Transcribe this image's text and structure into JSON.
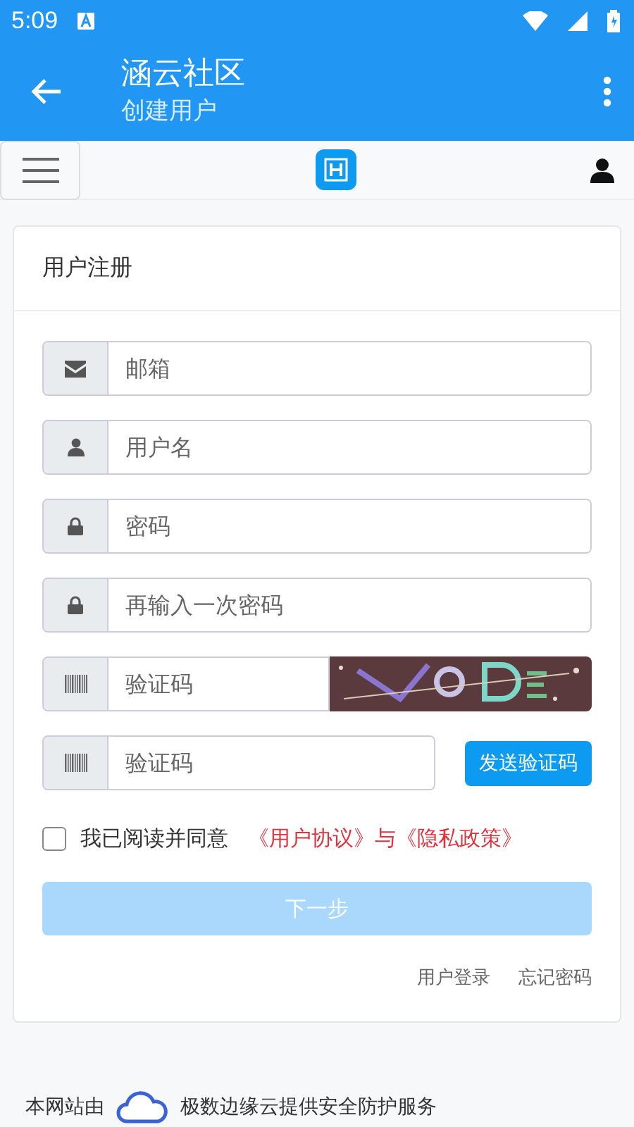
{
  "status_bar": {
    "time": "5:09"
  },
  "app_bar": {
    "title": "涵云社区",
    "subtitle": "创建用户"
  },
  "card": {
    "title": "用户注册",
    "fields": [
      {
        "kind": "mail",
        "placeholder": "邮箱"
      },
      {
        "kind": "user",
        "placeholder": "用户名"
      },
      {
        "kind": "lock",
        "placeholder": "密码"
      },
      {
        "kind": "lock",
        "placeholder": "再输入一次密码"
      },
      {
        "kind": "captcha",
        "placeholder": "验证码"
      },
      {
        "kind": "code",
        "placeholder": "验证码",
        "button": "发送验证码"
      }
    ],
    "agree": {
      "checked": false,
      "label": "我已阅读并同意",
      "links": "《用户协议》与《隐私政策》"
    },
    "submit": {
      "label": "下一步",
      "disabled": true
    },
    "links": [
      "用户登录",
      "忘记密码"
    ]
  },
  "footer": {
    "before": "本网站由",
    "after": "极数边缘云提供安全防护服务"
  }
}
